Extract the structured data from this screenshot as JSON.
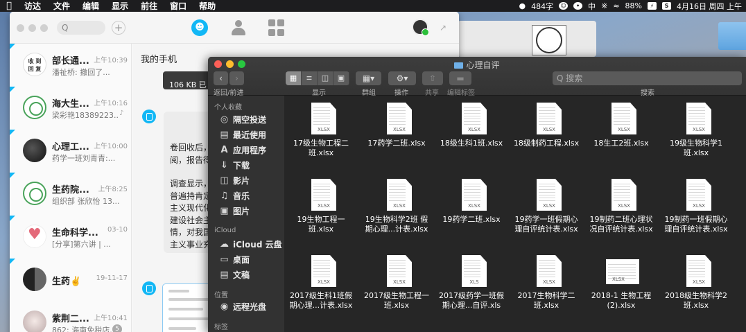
{
  "menubar": {
    "app_name": "访达",
    "items": [
      "文件",
      "编辑",
      "显示",
      "前往",
      "窗口",
      "帮助"
    ],
    "net_speed": "484字",
    "input_method": "中",
    "battery": "88%",
    "date_time": "4月16日 周四 上午"
  },
  "chat": {
    "search_placeholder": "Q",
    "conversation_title": "我的手机",
    "file_size_text": "106 KB  已",
    "conversations": [
      {
        "name": "部长通...",
        "time": "上午10:39",
        "preview": "潘祉桥: 撤回了...",
        "avatar_text": "收 到\n回 复"
      },
      {
        "name": "海大生...",
        "time": "上午10:16",
        "preview": "梁彩艳18389223..."
      },
      {
        "name": "心理工...",
        "time": "上午10:00",
        "preview": "药学一班刘青青:..."
      },
      {
        "name": "生药院...",
        "time": "上午8:25",
        "preview": "组织部 张欣怡 13..."
      },
      {
        "name": "生命科学...",
        "time": "03-10",
        "preview": "[分享]第六讲 | ..."
      },
      {
        "name": "生药✌️",
        "time": "19-11-17",
        "preview": ""
      },
      {
        "name": "紫荆二...",
        "time": "上午10:41",
        "preview": "862: 海南免税店...",
        "badge": "5"
      }
    ],
    "bubble_lines": [
      "卷回收后，",
      "阅，报告得",
      "",
      "调查显示，",
      "普遍持肯定",
      "主义现代化",
      "建设社会主",
      "情，对我国",
      "主义事业充"
    ]
  },
  "finder": {
    "title": "心理自评",
    "toolbar_labels": {
      "nav": "返回/前进",
      "view": "显示",
      "group": "群组",
      "action": "操作",
      "share": "共享",
      "tags": "编辑标签",
      "search": "搜索"
    },
    "search_placeholder": "Q 搜索",
    "sidebar": {
      "favorites_header": "个人收藏",
      "favorites": [
        {
          "label": "隔空投送",
          "icon": "airdrop-icon"
        },
        {
          "label": "最近使用",
          "icon": "clock-icon"
        },
        {
          "label": "应用程序",
          "icon": "applications-icon"
        },
        {
          "label": "下载",
          "icon": "download-icon"
        },
        {
          "label": "影片",
          "icon": "film-icon"
        },
        {
          "label": "音乐",
          "icon": "music-icon"
        },
        {
          "label": "图片",
          "icon": "camera-icon"
        }
      ],
      "icloud_header": "iCloud",
      "icloud": [
        {
          "label": "iCloud 云盘",
          "icon": "cloud-icon"
        },
        {
          "label": "桌面",
          "icon": "desktop-icon"
        },
        {
          "label": "文稿",
          "icon": "document-icon"
        }
      ],
      "locations_header": "位置",
      "locations": [
        {
          "label": "远程光盘",
          "icon": "disc-icon"
        }
      ],
      "tags_header": "标签"
    },
    "files": [
      {
        "name": "17级生物工程二\n班.xlsx",
        "ext": "XLSX"
      },
      {
        "name": "17药学二班.xlsx",
        "ext": "XLSX"
      },
      {
        "name": "18级生科1班.xlsx",
        "ext": "XLSX"
      },
      {
        "name": "18级制药工程.xlsx",
        "ext": "XLSX"
      },
      {
        "name": "18生工2班.xlsx",
        "ext": "XLSX"
      },
      {
        "name": "19级生物科学1\n班.xlsx",
        "ext": "XLSX"
      },
      {
        "name": "19生物工程一\n班.xlsx",
        "ext": "XLSX"
      },
      {
        "name": "19生物科学2班 假\n期心理...计表.xlsx",
        "ext": "XLSX"
      },
      {
        "name": "19药学二班.xlsx",
        "ext": "XLSX"
      },
      {
        "name": "19药学一班假期心\n理自评统计表.xlsx",
        "ext": "XLSX"
      },
      {
        "name": "19制药二班心理状\n况自评统计表.xlsx",
        "ext": "XLSX"
      },
      {
        "name": "19制药一班假期心\n理自评统计表.xlsx",
        "ext": "XLSX"
      },
      {
        "name": "2017级生科1班假\n期心理...计表.xlsx",
        "ext": "XLSX"
      },
      {
        "name": "2017级生物工程一\n班.xlsx",
        "ext": "XLSX"
      },
      {
        "name": "2017级药学一班假\n期心理...自评.xls",
        "ext": "XLS"
      },
      {
        "name": "2017生物科学二\n班.xlsx",
        "ext": "XLSX"
      },
      {
        "name": "2018-1 生物工程\n(2).xlsx",
        "ext": "XLSX"
      },
      {
        "name": "2018级生物科学2\n班.xlsx",
        "ext": "XLSX"
      }
    ]
  }
}
